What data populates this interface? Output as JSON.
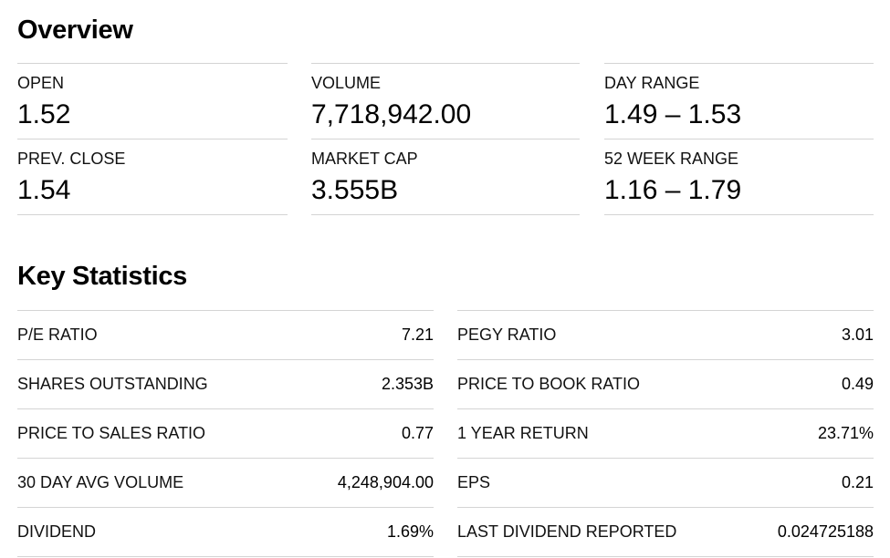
{
  "overview": {
    "title": "Overview",
    "columns": [
      [
        {
          "label": "OPEN",
          "value": "1.52"
        },
        {
          "label": "PREV. CLOSE",
          "value": "1.54"
        }
      ],
      [
        {
          "label": "VOLUME",
          "value": "7,718,942.00"
        },
        {
          "label": "MARKET CAP",
          "value": "3.555B"
        }
      ],
      [
        {
          "label": "DAY RANGE",
          "value": "1.49 – 1.53"
        },
        {
          "label": "52 WEEK RANGE",
          "value": "1.16 – 1.79"
        }
      ]
    ]
  },
  "key_statistics": {
    "title": "Key Statistics",
    "left": [
      {
        "label": "P/E RATIO",
        "value": "7.21"
      },
      {
        "label": "SHARES OUTSTANDING",
        "value": "2.353B"
      },
      {
        "label": "PRICE TO SALES RATIO",
        "value": "0.77"
      },
      {
        "label": "30 DAY AVG VOLUME",
        "value": "4,248,904.00"
      },
      {
        "label": "DIVIDEND",
        "value": "1.69%"
      }
    ],
    "right": [
      {
        "label": "PEGY RATIO",
        "value": "3.01"
      },
      {
        "label": "PRICE TO BOOK RATIO",
        "value": "0.49"
      },
      {
        "label": "1 YEAR RETURN",
        "value": "23.71%"
      },
      {
        "label": "EPS",
        "value": "0.21"
      },
      {
        "label": "LAST DIVIDEND REPORTED",
        "value": "0.024725188"
      }
    ]
  }
}
